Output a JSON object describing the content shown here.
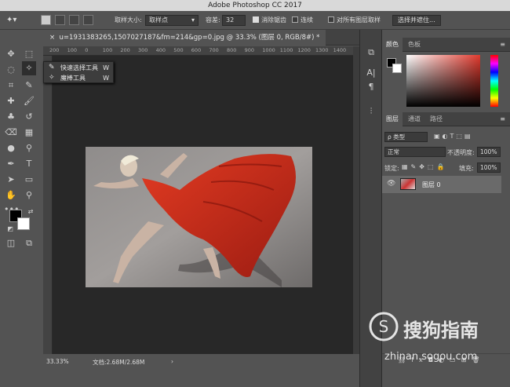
{
  "app": {
    "title": "Adobe Photoshop CC 2017"
  },
  "options": {
    "sample_size_label": "取样大小:",
    "sample_size_value": "取样点",
    "tolerance_label": "容差:",
    "tolerance_value": "32",
    "antialias_label": "消除锯齿",
    "contiguous_label": "连续",
    "all_layers_label": "对所有图层取样",
    "select_mask_button": "选择并遮住..."
  },
  "document": {
    "tab_label": "u=1931383265,1507027187&fm=214&gp=0.jpg @ 33.3% (图层 0, RGB/8#) *",
    "close_glyph": "×"
  },
  "ruler": {
    "ticks": [
      "200",
      "100",
      "0",
      "100",
      "200",
      "300",
      "400",
      "500",
      "600",
      "700",
      "800",
      "900",
      "1000",
      "1100",
      "1200",
      "1300",
      "1400"
    ]
  },
  "flyout": {
    "items": [
      {
        "label": "快速选择工具",
        "key": "W"
      },
      {
        "label": "魔棒工具",
        "key": "W"
      }
    ]
  },
  "status": {
    "zoom": "33.33%",
    "doc_info": "文档:2.68M/2.68M",
    "arrow": "›"
  },
  "color_panel": {
    "tabs": [
      "颜色",
      "色板"
    ]
  },
  "layers_panel": {
    "tabs": [
      "图层",
      "通道",
      "路径"
    ],
    "filter_label": "ρ 类型",
    "blend_mode": "正常",
    "opacity_label": "不透明度:",
    "opacity_value": "100%",
    "lock_label": "锁定:",
    "fill_label": "填充:",
    "fill_value": "100%",
    "layer_name": "图层 0",
    "footer_fx": "fx"
  },
  "watermark": {
    "brand": "搜狗指南",
    "url": "zhinan.sogou.com"
  },
  "colors": {
    "accent_red": "#e03a2e",
    "panel_bg": "#535353",
    "canvas_bg": "#282828"
  }
}
